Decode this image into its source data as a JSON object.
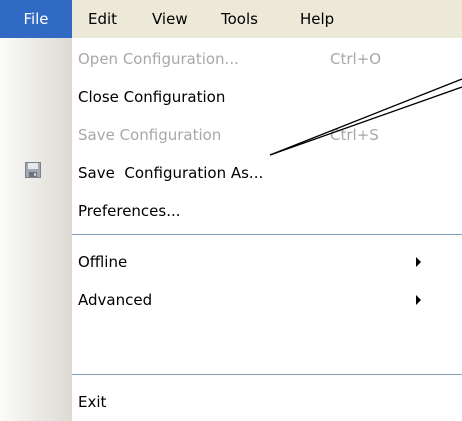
{
  "menubar": {
    "items": [
      "File",
      "Edit",
      "View",
      "Tools",
      "Help"
    ]
  },
  "file_menu": {
    "items": [
      {
        "label": "Open Configuration...",
        "shortcut": "Ctrl+O",
        "enabled": false
      },
      {
        "label": "Close Configuration",
        "shortcut": "",
        "enabled": true
      },
      {
        "label": "Save Configuration",
        "shortcut": "Ctrl+S",
        "enabled": false,
        "icon": "save-icon"
      },
      {
        "label": "Save  Configuration As...",
        "shortcut": "",
        "enabled": true
      },
      {
        "label": "Preferences...",
        "shortcut": "",
        "enabled": true
      },
      {
        "label": "Offline",
        "shortcut": "",
        "enabled": true,
        "submenu": true
      },
      {
        "label": "Advanced",
        "shortcut": "",
        "enabled": true,
        "submenu": true
      },
      {
        "label": "Exit",
        "shortcut": "",
        "enabled": true
      }
    ]
  },
  "colors": {
    "menu_highlight": "#316ac5",
    "menubar_bg": "#ece9d8",
    "disabled_text": "#a8a8a8",
    "separator": "#7f9db9"
  }
}
